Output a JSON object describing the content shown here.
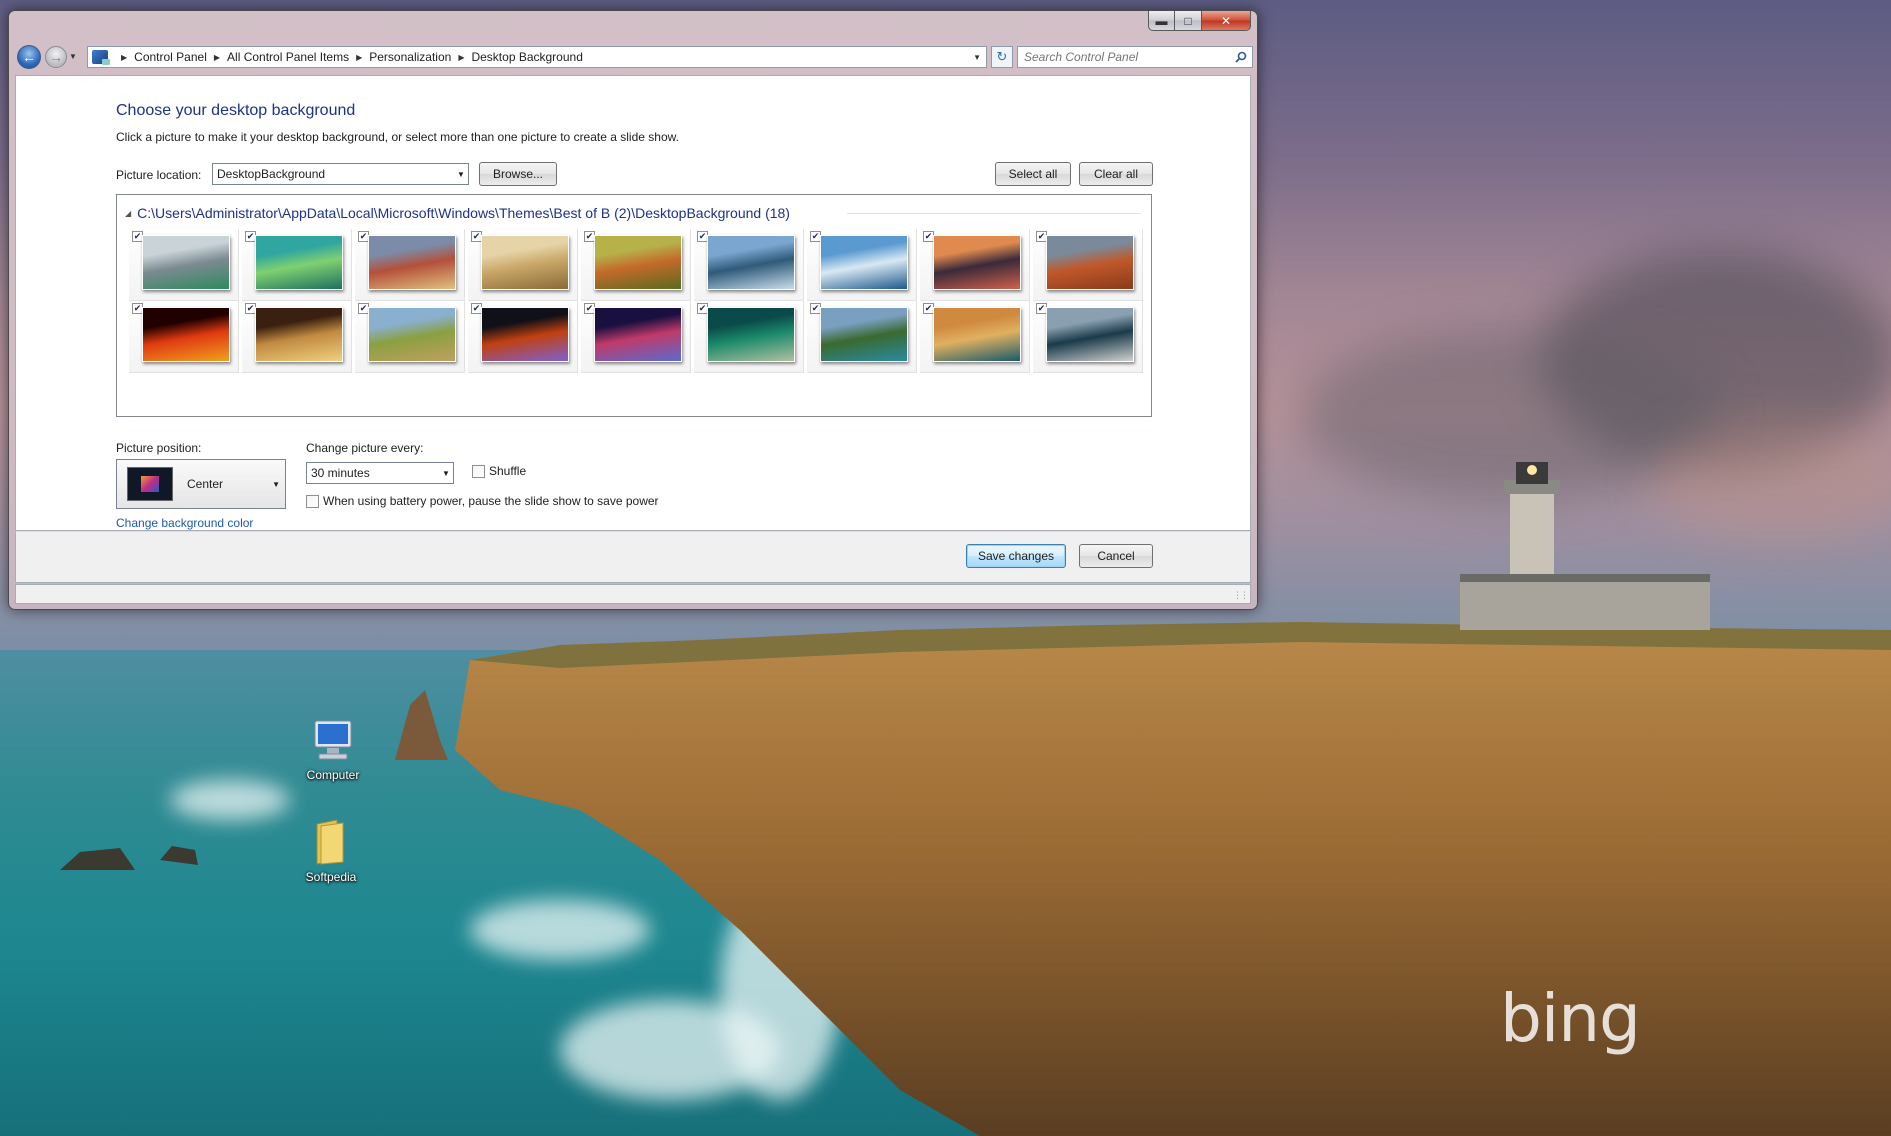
{
  "window": {
    "address": {
      "crumbs": [
        "Control Panel",
        "All Control Panel Items",
        "Personalization",
        "Desktop Background"
      ]
    },
    "search": {
      "placeholder": "Search Control Panel"
    }
  },
  "page": {
    "title": "Choose your desktop background",
    "subtitle": "Click a picture to make it your desktop background, or select more than one picture to create a slide show.",
    "location_label": "Picture location:",
    "location_value": "DesktopBackground",
    "browse_label": "Browse...",
    "select_all_label": "Select all",
    "clear_all_label": "Clear all",
    "folder_path": "C:\\Users\\Administrator\\AppData\\Local\\Microsoft\\Windows\\Themes\\Best of B (2)\\DesktopBackground (18)",
    "thumbnails": [
      {
        "checked": true,
        "colors": [
          "#c9d3d8",
          "#7a8a90",
          "#2e8a5e"
        ],
        "icon": "shark-thumbnail"
      },
      {
        "checked": true,
        "colors": [
          "#2fa6a0",
          "#7fd070",
          "#1e7060"
        ],
        "icon": "green-leaf-thumbnail"
      },
      {
        "checked": true,
        "colors": [
          "#7c8ca8",
          "#b4503a",
          "#e0c080"
        ],
        "icon": "coastal-rocks-thumbnail"
      },
      {
        "checked": true,
        "colors": [
          "#e6d4a8",
          "#c9a768",
          "#8a6a38"
        ],
        "icon": "desert-dunes-thumbnail"
      },
      {
        "checked": true,
        "colors": [
          "#b7b14a",
          "#c46a2a",
          "#5a6a20"
        ],
        "icon": "fox-thumbnail"
      },
      {
        "checked": true,
        "colors": [
          "#7aa6d0",
          "#2f5a7a",
          "#c8dcea"
        ],
        "icon": "island-reflection-thumbnail"
      },
      {
        "checked": true,
        "colors": [
          "#5a9ad0",
          "#d8e8f4",
          "#1e5a8a"
        ],
        "icon": "boats-thumbnail"
      },
      {
        "checked": true,
        "colors": [
          "#e08a50",
          "#3a2a3a",
          "#d0604a"
        ],
        "icon": "sunset-town-thumbnail"
      },
      {
        "checked": true,
        "colors": [
          "#7a8a9a",
          "#c0582a",
          "#8a3a1a"
        ],
        "icon": "monument-valley-thumbnail"
      },
      {
        "checked": true,
        "colors": [
          "#200000",
          "#e03a10",
          "#f0a020"
        ],
        "icon": "sun-thumbnail"
      },
      {
        "checked": true,
        "colors": [
          "#3a2010",
          "#c08a40",
          "#f0d080"
        ],
        "icon": "royal-albert-hall-thumbnail"
      },
      {
        "checked": true,
        "colors": [
          "#8ab0d0",
          "#8aa040",
          "#c0a060"
        ],
        "icon": "lions-thumbnail"
      },
      {
        "checked": true,
        "colors": [
          "#101018",
          "#c04010",
          "#8060d0"
        ],
        "icon": "lightning-thumbnail"
      },
      {
        "checked": true,
        "colors": [
          "#1a1040",
          "#c03a6a",
          "#5a6ad0"
        ],
        "icon": "nebula-thumbnail"
      },
      {
        "checked": true,
        "colors": [
          "#0a4a4a",
          "#1a8a6a",
          "#b0c0a0"
        ],
        "icon": "reef-island-thumbnail"
      },
      {
        "checked": true,
        "colors": [
          "#7aa0c0",
          "#3a6a30",
          "#2a8aa0"
        ],
        "icon": "mountain-lake-thumbnail"
      },
      {
        "checked": true,
        "colors": [
          "#d08a40",
          "#e0b060",
          "#1a5a6a"
        ],
        "icon": "sand-coast-thumbnail"
      },
      {
        "checked": true,
        "colors": [
          "#8aa0b0",
          "#1a3a4a",
          "#d0d0d0"
        ],
        "icon": "harbor-town-thumbnail"
      }
    ],
    "position_label": "Picture position:",
    "position_value": "Center",
    "change_label": "Change picture every:",
    "change_value": "30 minutes",
    "shuffle_label": "Shuffle",
    "battery_label": "When using battery power, pause the slide show to save power",
    "bg_color_link": "Change background color",
    "save_label": "Save changes",
    "cancel_label": "Cancel"
  },
  "desktop": {
    "icons": [
      {
        "label": "Computer",
        "icon": "computer-icon"
      },
      {
        "label": "Softpedia",
        "icon": "folder-icon"
      }
    ],
    "watermark": "bing"
  }
}
